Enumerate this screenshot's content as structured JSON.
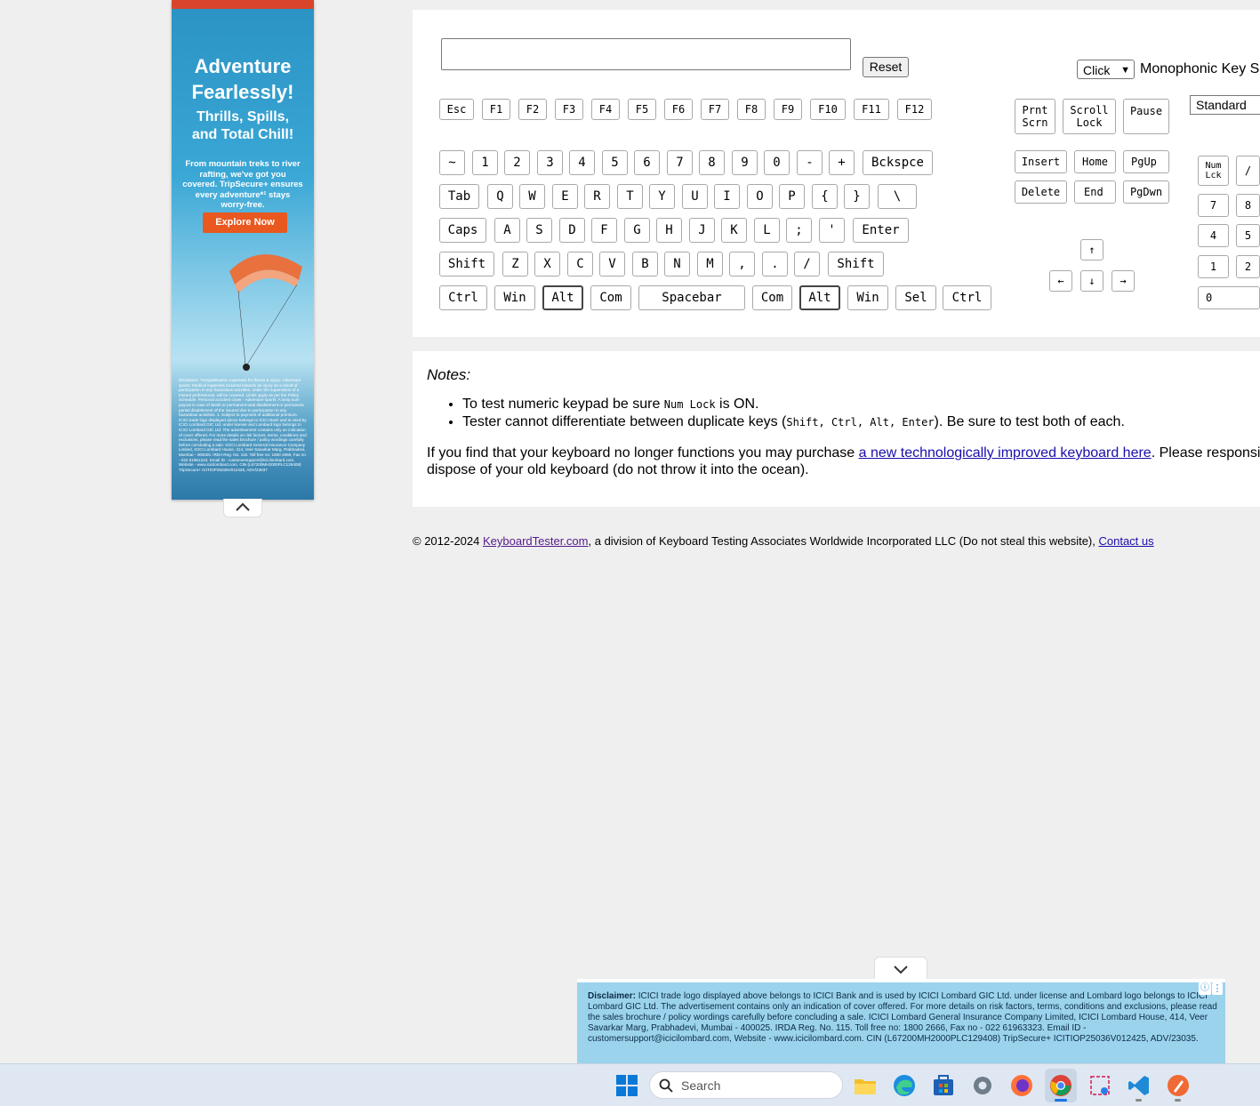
{
  "ad_left": {
    "headline": "Adventure Fearlessly!",
    "subhead": "Thrills, Spills, and Total Chill!",
    "body": "From mountain treks to river rafting, we've got you covered. TripSecure+ ensures every adventure*¹ stays worry-free.",
    "cta": "Explore Now",
    "disclaimer": "Disclaimer: *Hospitalisation expenses for illness & injury- Adventure sports: Medical expenses incurred towards an injury as a result of participation in any hazardous activities, under the supervision of a trained professional, will be covered. Limits apply as per the Policy Schedule. Personal accident cover - Adventure sports: A lump sum payout in case of death or permanent total disablement or permanent partial disablement of the insured due to participation in any hazardous activities. 1. Subject to payment of additional premium. ICICI trade logo displayed above belongs to ICICI Bank and is used by ICICI Lombard GIC Ltd. under license and Lombard logo belongs to ICICI Lombard GIC Ltd. The advertisement contains only an indication of cover offered. For more details on risk factors, terms, conditions and exclusions, please read the sales brochure / policy wordings carefully before concluding a sale. ICICI Lombard General Insurance Company Limited, ICICI Lombard House, 414, Veer Savarkar Marg, Prabhadevi, Mumbai - 400025. IRDA Reg. No. 115. Toll free no: 1800 2666, Fax no - 022 61961323. Email ID - customersupport@icicilombard.com, Website - www.icicilombard.com. CIN (L67200MH2000PLC129408) TripSecure+ ICITIOP25036V012425, ADV/23037"
  },
  "controls": {
    "reset": "Reset",
    "mode_select": "Click",
    "mono_label": "Monophonic Key Sc",
    "layout_select": "Standard"
  },
  "keys": {
    "fn_row": [
      "Esc",
      "F1",
      "F2",
      "F3",
      "F4",
      "F5",
      "F6",
      "F7",
      "F8",
      "F9",
      "F10",
      "F11",
      "F12"
    ],
    "num_row": [
      "~",
      "1",
      "2",
      "3",
      "4",
      "5",
      "6",
      "7",
      "8",
      "9",
      "0",
      "-",
      "+",
      "Bckspce"
    ],
    "tab_row": [
      "Tab",
      "Q",
      "W",
      "E",
      "R",
      "T",
      "Y",
      "U",
      "I",
      "O",
      "P",
      "{",
      "}",
      "\\"
    ],
    "caps_row": [
      "Caps",
      "A",
      "S",
      "D",
      "F",
      "G",
      "H",
      "J",
      "K",
      "L",
      ";",
      "'",
      "Enter"
    ],
    "shift_row": [
      "Shift",
      "Z",
      "X",
      "C",
      "V",
      "B",
      "N",
      "M",
      ",",
      ".",
      "/",
      "Shift"
    ],
    "bottom_row": [
      "Ctrl",
      "Win",
      "Alt",
      "Com",
      "Spacebar",
      "Com",
      "Alt",
      "Win",
      "Sel",
      "Ctrl"
    ],
    "sys": [
      "Prnt Scrn",
      "Scroll Lock",
      "Pause"
    ],
    "nav": [
      "Insert",
      "Home",
      "PgUp",
      "Delete",
      "End",
      "PgDwn"
    ],
    "arrows": [
      "↑",
      "←",
      "↓",
      "→"
    ],
    "numpad": [
      "Num Lck",
      "/",
      "7",
      "8",
      "4",
      "5",
      "1",
      "2",
      "0"
    ]
  },
  "notes": {
    "title": "Notes:",
    "item1_pre": "To test numeric keypad be sure ",
    "item1_code": "Num Lock",
    "item1_post": " is ON.",
    "item2_pre": "Tester cannot differentiate between duplicate keys (",
    "item2_code": "Shift, Ctrl, Alt, Enter",
    "item2_post": "). Be sure to test both of each.",
    "para_pre": "If you find that your keyboard no longer functions you may purchase ",
    "para_link": "a new technologically improved keyboard here",
    "para_post": ". Please responsibly dispose of your old keyboard (do not throw it into the ocean)."
  },
  "footer": {
    "pre": "© 2012-2024 ",
    "site_link": "KeyboardTester.com",
    "mid": ", a division of Keyboard Testing Associates Worldwide Incorporated LLC (Do not steal this website), ",
    "contact_link": "Contact us"
  },
  "ad_bottom": {
    "text_bold": "Disclaimer:",
    "text": " ICICI trade logo displayed above belongs to ICICI Bank and is used by ICICI Lombard GIC Ltd. under license and Lombard logo belongs to ICICI Lombard GIC Ltd. The advertisement contains only an indication of cover offered. For more details on risk factors, terms, conditions and exclusions, please read the sales brochure / policy wordings carefully before concluding a sale. ICICI Lombard General Insurance Company Limited, ICICI Lombard House, 414, Veer Savarkar Marg, Prabhadevi, Mumbai - 400025. IRDA Reg. No. 115. Toll free no: 1800 2666, Fax no - 022 61963323. Email ID - customersupport@icicilombard.com, Website - www.icicilombard.com. CIN (L67200MH2000PLC129408) TripSecure+ ICITIOP25036V012425, ADV/23035."
  },
  "taskbar": {
    "search_placeholder": "Search",
    "icons": [
      "windows-start-icon",
      "search-icon",
      "file-explorer-icon",
      "edge-icon",
      "store-icon",
      "settings-icon",
      "firefox-icon",
      "chrome-icon",
      "snipping-tool-icon",
      "vscode-icon",
      "pen-app-icon"
    ]
  }
}
